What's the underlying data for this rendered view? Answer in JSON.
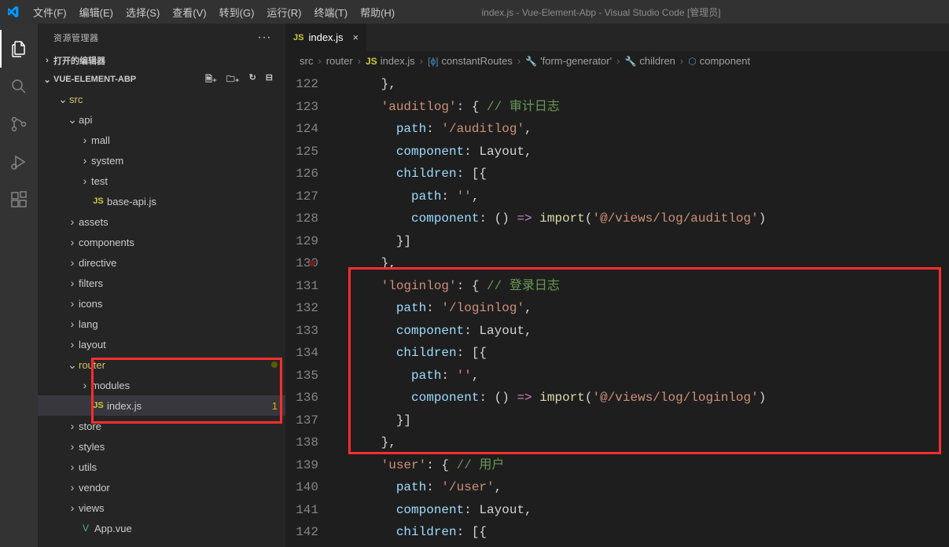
{
  "titleBar": {
    "menus": [
      "文件(F)",
      "编辑(E)",
      "选择(S)",
      "查看(V)",
      "转到(G)",
      "运行(R)",
      "终端(T)",
      "帮助(H)"
    ],
    "title": "index.js - Vue-Element-Abp - Visual Studio Code [管理员]"
  },
  "sidebar": {
    "title": "资源管理器",
    "openEditors": "打开的编辑器",
    "project": "VUE-ELEMENT-ABP",
    "tree": [
      {
        "label": "src",
        "kind": "folder-open",
        "indent": 24,
        "hl": true
      },
      {
        "label": "api",
        "kind": "folder-open",
        "indent": 36
      },
      {
        "label": "mall",
        "kind": "folder",
        "indent": 52
      },
      {
        "label": "system",
        "kind": "folder",
        "indent": 52
      },
      {
        "label": "test",
        "kind": "folder",
        "indent": 52
      },
      {
        "label": "base-api.js",
        "kind": "js",
        "indent": 52
      },
      {
        "label": "assets",
        "kind": "folder",
        "indent": 36
      },
      {
        "label": "components",
        "kind": "folder",
        "indent": 36
      },
      {
        "label": "directive",
        "kind": "folder",
        "indent": 36
      },
      {
        "label": "filters",
        "kind": "folder",
        "indent": 36
      },
      {
        "label": "icons",
        "kind": "folder",
        "indent": 36
      },
      {
        "label": "lang",
        "kind": "folder",
        "indent": 36
      },
      {
        "label": "layout",
        "kind": "folder",
        "indent": 36
      },
      {
        "label": "router",
        "kind": "folder-open",
        "indent": 36,
        "hl": true,
        "dot": true
      },
      {
        "label": "modules",
        "kind": "folder",
        "indent": 52
      },
      {
        "label": "index.js",
        "kind": "js",
        "indent": 52,
        "active": true,
        "count": "1"
      },
      {
        "label": "store",
        "kind": "folder",
        "indent": 36
      },
      {
        "label": "styles",
        "kind": "folder",
        "indent": 36
      },
      {
        "label": "utils",
        "kind": "folder",
        "indent": 36
      },
      {
        "label": "vendor",
        "kind": "folder",
        "indent": 36
      },
      {
        "label": "views",
        "kind": "folder",
        "indent": 36
      },
      {
        "label": "App.vue",
        "kind": "vue",
        "indent": 36
      }
    ]
  },
  "editor": {
    "tabLabel": "index.js",
    "breadcrumbs": [
      "src",
      "router",
      "index.js",
      "constantRoutes",
      "'form-generator'",
      "children",
      "component"
    ],
    "lineStart": 122,
    "lineEnd": 142,
    "code": {
      "l122": "},",
      "l123_key": "'auditlog'",
      "l123_cmt": "// 审计日志",
      "l124_k": "path",
      "l124_v": "'/auditlog'",
      "l125_k": "component",
      "l125_v": "Layout",
      "l126_k": "children",
      "l127_k": "path",
      "l127_v": "''",
      "l128_k": "component",
      "l128_imp": "import",
      "l128_v": "'@/views/log/auditlog'",
      "l131_key": "'loginlog'",
      "l131_cmt": "// 登录日志",
      "l132_k": "path",
      "l132_v": "'/loginlog'",
      "l133_k": "component",
      "l133_v": "Layout",
      "l134_k": "children",
      "l135_k": "path",
      "l135_v": "''",
      "l136_k": "component",
      "l136_imp": "import",
      "l136_v": "'@/views/log/loginlog'",
      "l139_key": "'user'",
      "l139_cmt": "// 用户",
      "l140_k": "path",
      "l140_v": "'/user'",
      "l141_k": "component",
      "l141_v": "Layout",
      "l142_k": "children"
    }
  }
}
